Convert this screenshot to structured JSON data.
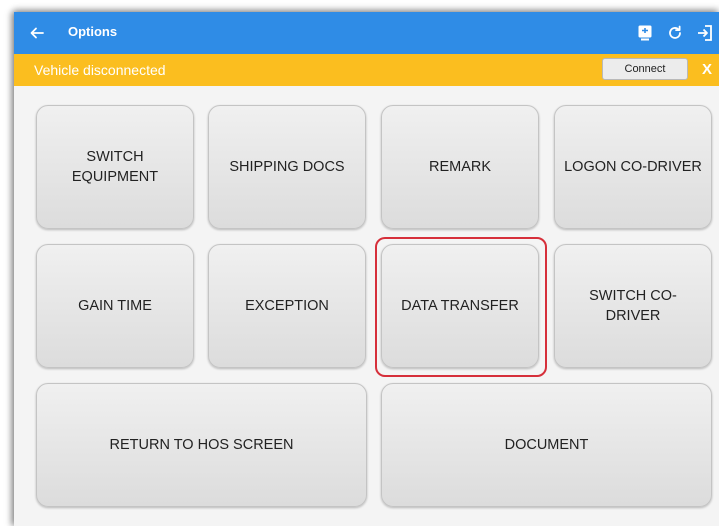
{
  "appbar": {
    "title": "Options",
    "back_icon": "arrow-left-icon",
    "bg_color": "#2f8ce6",
    "actions": [
      "device-sync-icon",
      "refresh-icon",
      "logout-icon"
    ]
  },
  "banner": {
    "message": "Vehicle disconnected",
    "connect_label": "Connect",
    "close_label": "X",
    "bg_color": "#fbbe1f"
  },
  "menu": {
    "switch_equipment": "SWITCH EQUIPMENT",
    "shipping_docs": "SHIPPING DOCS",
    "remark": "REMARK",
    "logon_co_driver": "LOGON CO-DRIVER",
    "gain_time": "GAIN TIME",
    "exception": "EXCEPTION",
    "data_transfer": "DATA TRANSFER",
    "switch_co_driver": "SWITCH CO-DRIVER",
    "return_to_hos": "RETURN TO HOS SCREEN",
    "document": "DOCUMENT"
  },
  "highlight_color": "#d62f3a"
}
